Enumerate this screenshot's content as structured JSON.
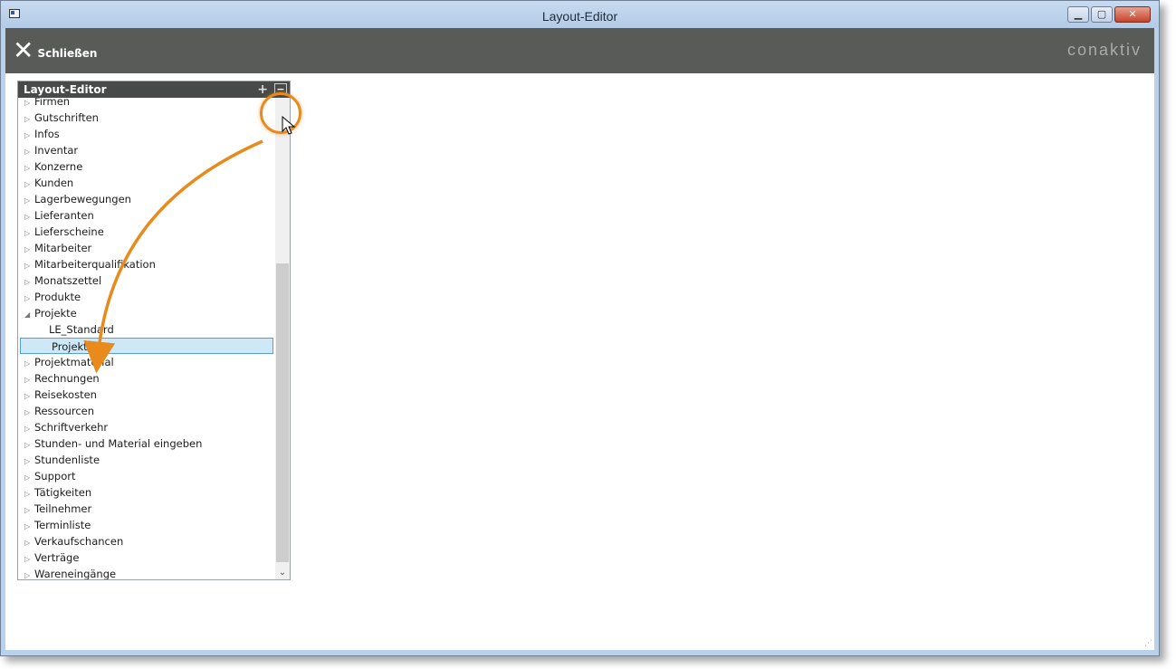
{
  "window": {
    "title": "Layout-Editor"
  },
  "toolbar": {
    "close_label": "Schließen",
    "brand": "conaktiv"
  },
  "panel": {
    "title": "Layout-Editor",
    "plus_label": "+",
    "minimize_label": "−",
    "items": [
      {
        "label": "Firmen",
        "type": "collapsed"
      },
      {
        "label": "Gutschriften",
        "type": "collapsed"
      },
      {
        "label": "Infos",
        "type": "collapsed"
      },
      {
        "label": "Inventar",
        "type": "collapsed"
      },
      {
        "label": "Konzerne",
        "type": "collapsed"
      },
      {
        "label": "Kunden",
        "type": "collapsed"
      },
      {
        "label": "Lagerbewegungen",
        "type": "collapsed"
      },
      {
        "label": "Lieferanten",
        "type": "collapsed"
      },
      {
        "label": "Lieferscheine",
        "type": "collapsed"
      },
      {
        "label": "Mitarbeiter",
        "type": "collapsed"
      },
      {
        "label": "Mitarbeiterqualifikation",
        "type": "collapsed"
      },
      {
        "label": "Monatszettel",
        "type": "collapsed"
      },
      {
        "label": "Produkte",
        "type": "collapsed"
      },
      {
        "label": "Projekte",
        "type": "expanded"
      },
      {
        "label": "LE_Standard",
        "type": "child"
      },
      {
        "label": "Projekte",
        "type": "child-selected"
      },
      {
        "label": "Projektmaterial",
        "type": "collapsed"
      },
      {
        "label": "Rechnungen",
        "type": "collapsed"
      },
      {
        "label": "Reisekosten",
        "type": "collapsed"
      },
      {
        "label": "Ressourcen",
        "type": "collapsed"
      },
      {
        "label": "Schriftverkehr",
        "type": "collapsed"
      },
      {
        "label": "Stunden- und Material eingeben",
        "type": "collapsed"
      },
      {
        "label": "Stundenliste",
        "type": "collapsed"
      },
      {
        "label": "Support",
        "type": "collapsed"
      },
      {
        "label": "Tätigkeiten",
        "type": "collapsed"
      },
      {
        "label": "Teilnehmer",
        "type": "collapsed"
      },
      {
        "label": "Terminliste",
        "type": "collapsed"
      },
      {
        "label": "Verkaufschancen",
        "type": "collapsed"
      },
      {
        "label": "Verträge",
        "type": "collapsed"
      },
      {
        "label": "Wareneingänge",
        "type": "collapsed"
      }
    ]
  },
  "colors": {
    "toolbar_bg": "#595b59",
    "panel_header_bg": "#474a48",
    "selected_bg": "#cfe8f8",
    "selected_border": "#56a0d6",
    "callout": "#e88a1c"
  },
  "icons": {
    "close": "close-icon",
    "collapsed": "triangle-right-icon",
    "expanded": "triangle-down-icon",
    "cursor": "mouse-pointer-icon"
  }
}
